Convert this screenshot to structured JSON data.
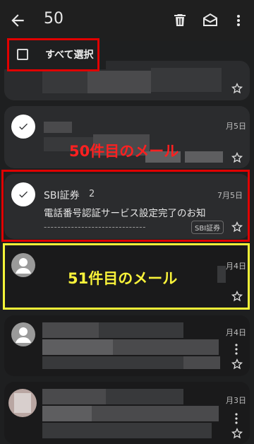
{
  "toolbar": {
    "selected_count": "50",
    "icons": [
      "back-arrow-icon",
      "trash-icon",
      "mark-read-envelope-icon",
      "more-vert-icon"
    ]
  },
  "select_all": {
    "label": "すべて選択"
  },
  "emails": [
    {
      "state": "partially-visible",
      "date": ""
    },
    {
      "state": "selected",
      "date": "月5日"
    },
    {
      "state": "selected",
      "sender": "SBI証券",
      "thread_count": "2",
      "date": "7月5日",
      "subject": "電話番号認証サービス設定完了のお知",
      "snippet": "------------------------------",
      "label": "SBI証券"
    },
    {
      "state": "unselected",
      "date": "月4日"
    },
    {
      "state": "unselected",
      "date": "月4日"
    },
    {
      "state": "unselected",
      "date": "月3日"
    }
  ],
  "annotations": {
    "fiftieth": "50件目のメール",
    "fifty_first": "51件目のメール"
  },
  "colors": {
    "highlight_red": "#e00000",
    "highlight_yellow": "#f5f538",
    "background": "#1e1f20"
  }
}
